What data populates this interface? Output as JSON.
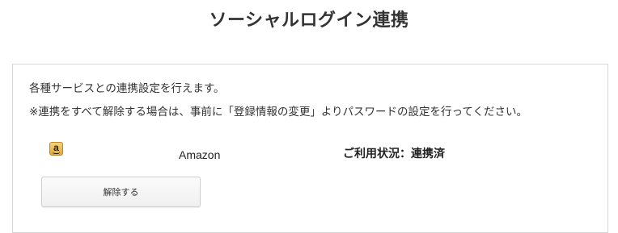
{
  "page": {
    "title": "ソーシャルログイン連携"
  },
  "description": {
    "line1": "各種サービスとの連携設定を行えます。",
    "line2": "※連携をすべて解除する場合は、事前に「登録情報の変更」よりパスワードの設定を行ってください。"
  },
  "services": [
    {
      "icon": "amazon-icon",
      "icon_glyph": "a",
      "name": "Amazon",
      "status": "ご利用状況：連携済",
      "action_label": "解除する"
    }
  ],
  "colors": {
    "panel_border": "#d6d6d6",
    "button_border": "#cfcfcf",
    "text": "#222222",
    "amazon_icon": "#e8b04a"
  }
}
